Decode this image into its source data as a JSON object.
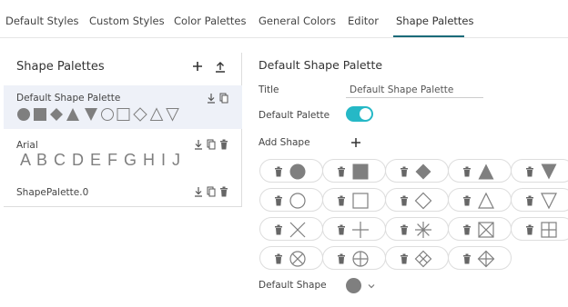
{
  "tabs": [
    {
      "label": "Default Styles"
    },
    {
      "label": "Custom Styles"
    },
    {
      "label": "Color Palettes"
    },
    {
      "label": "General Colors"
    },
    {
      "label": "Editor"
    },
    {
      "label": "Shape Palettes",
      "active": true
    }
  ],
  "left_panel": {
    "title": "Shape Palettes",
    "tools": [
      "plus-icon",
      "upload-icon"
    ],
    "palettes": [
      {
        "name": "Default Shape Palette",
        "selected": true,
        "actions": [
          "download-icon",
          "copy-icon"
        ],
        "preview_shapes": [
          "circle",
          "square",
          "diamond",
          "triangle",
          "triangle-down",
          "circle-outline",
          "square-outline",
          "diamond-outline",
          "triangle-outline",
          "triangle-down-outline"
        ]
      },
      {
        "name": "Arial",
        "selected": false,
        "actions": [
          "download-icon",
          "copy-icon",
          "trash-icon"
        ],
        "preview_text": "A B C D E F G H I J"
      },
      {
        "name": "ShapePalette.0",
        "selected": false,
        "actions": [
          "download-icon",
          "copy-icon",
          "trash-icon"
        ]
      }
    ]
  },
  "editor": {
    "title": "Default Shape Palette",
    "title_label": "Title",
    "title_value": "Default Shape Palette",
    "default_palette_label": "Default Palette",
    "default_palette_on": true,
    "add_shape_label": "Add Shape",
    "shapes": [
      "circle",
      "square",
      "diamond",
      "triangle",
      "triangle-down",
      "circle-outline",
      "square-outline",
      "diamond-outline",
      "triangle-outline",
      "triangle-down-outline",
      "x-cross",
      "plus",
      "asterisk",
      "box-x",
      "box-plus",
      "circle-x",
      "circle-plus",
      "diamond-x",
      "diamond-plus"
    ],
    "default_shape_label": "Default Shape",
    "default_shape": "circle"
  },
  "colors": {
    "accent": "#25b8c6",
    "tab_underline": "#1a6b79",
    "shape_fill": "#7f7f7f",
    "selected_bg": "#eef1f8"
  }
}
